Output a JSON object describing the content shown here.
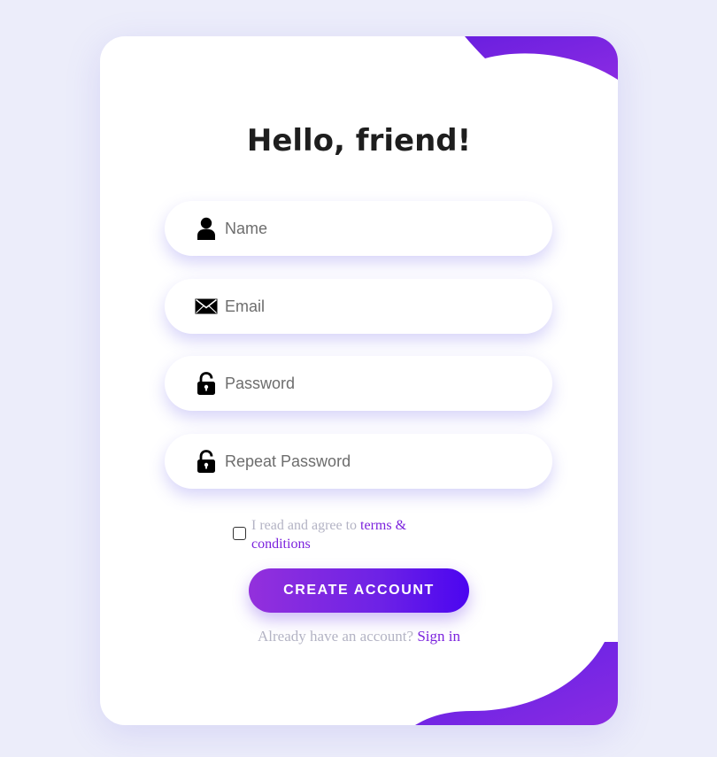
{
  "title": "Hello, friend!",
  "fields": {
    "name": {
      "placeholder": "Name",
      "value": "",
      "icon": "user-icon"
    },
    "email": {
      "placeholder": "Email",
      "value": "",
      "icon": "envelope-icon"
    },
    "password": {
      "placeholder": "Password",
      "value": "",
      "icon": "unlock-icon"
    },
    "repeat_password": {
      "placeholder": "Repeat Password",
      "value": "",
      "icon": "unlock-icon"
    }
  },
  "terms": {
    "checked": false,
    "prefix": "I read and agree to ",
    "link_text": "terms & conditions"
  },
  "create_button": {
    "label": "CREATE ACCOUNT"
  },
  "signin": {
    "prompt": "Already have an account? ",
    "link_text": "Sign in"
  },
  "colors": {
    "background": "#ecedfa",
    "card": "#ffffff",
    "accent_purple": "#7b22dd",
    "accent_indigo": "#4b05f0",
    "muted_text": "#b3b3c4"
  }
}
